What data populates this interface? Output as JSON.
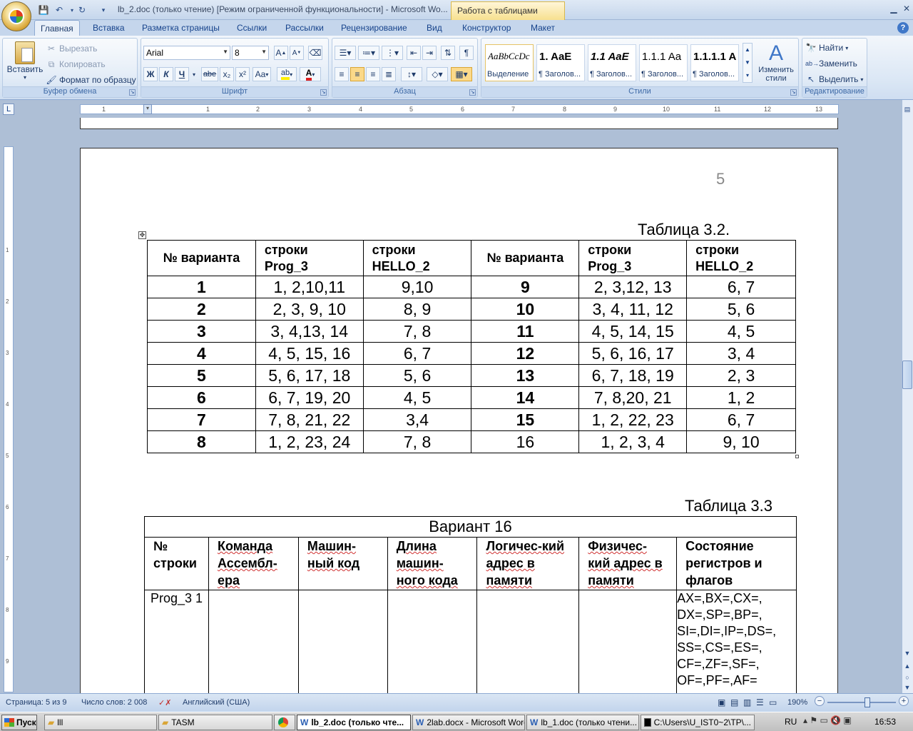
{
  "title_bar": {
    "document_title": "lb_2.doc (только чтение) [Режим ограниченной функциональности] - Microsoft Wo...",
    "context_tab": "Работа с таблицами"
  },
  "tabs": [
    "Главная",
    "Вставка",
    "Разметка страницы",
    "Ссылки",
    "Рассылки",
    "Рецензирование",
    "Вид",
    "Конструктор",
    "Макет"
  ],
  "ribbon": {
    "clipboard": {
      "paste": "Вставить",
      "cut": "Вырезать",
      "copy": "Копировать",
      "format_painter": "Формат по образцу",
      "label": "Буфер обмена"
    },
    "font": {
      "font_name": "Arial",
      "font_size": "8",
      "label": "Шрифт",
      "bold": "Ж",
      "italic": "К",
      "underline": "Ч",
      "strike": "abe",
      "sub": "x₂",
      "sup": "x²",
      "case": "Aa",
      "color": "A"
    },
    "paragraph": {
      "label": "Абзац"
    },
    "styles": {
      "label": "Стили",
      "items": [
        {
          "preview": "AaBbCcDc",
          "name": "Выделение"
        },
        {
          "preview": "1.  AaE",
          "name": "¶ Заголов..."
        },
        {
          "preview": "1.1  AaE",
          "name": "¶ Заголов..."
        },
        {
          "preview": "1.1.1  Aa",
          "name": "¶ Заголов..."
        },
        {
          "preview": "1.1.1.1  A",
          "name": "¶ Заголов..."
        }
      ],
      "change_styles": "Изменить стили"
    },
    "editing": {
      "find": "Найти",
      "replace": "Заменить",
      "select": "Выделить",
      "label": "Редактирование"
    }
  },
  "ruler_numbers": [
    "1",
    "1",
    "2",
    "3",
    "4",
    "5",
    "6",
    "7",
    "8",
    "9",
    "10",
    "11",
    "12",
    "13"
  ],
  "vruler_numbers": [
    "1",
    "2",
    "3",
    "4",
    "5",
    "6",
    "7",
    "8",
    "9"
  ],
  "document": {
    "page_number": "5",
    "table32": {
      "caption": "Таблица 3.2.",
      "headers": [
        "№ варианта",
        "строки Prog_3",
        "строки HELLO_2",
        "№ варианта",
        "строки Prog_3",
        "строки HELLO_2"
      ],
      "rows": [
        [
          "1",
          "1, 2,10,11",
          "9,10",
          "9",
          "2, 3,12, 13",
          "6, 7"
        ],
        [
          "2",
          "2, 3, 9, 10",
          "8, 9",
          "10",
          "3, 4, 11, 12",
          "5, 6"
        ],
        [
          "3",
          "3, 4,13, 14",
          "7, 8",
          "11",
          "4, 5, 14, 15",
          "4, 5"
        ],
        [
          "4",
          "4, 5, 15, 16",
          "6, 7",
          "12",
          "5, 6, 16, 17",
          "3, 4"
        ],
        [
          "5",
          "5, 6, 17, 18",
          "5, 6",
          "13",
          "6, 7, 18, 19",
          "2, 3"
        ],
        [
          "6",
          "6, 7, 19, 20",
          "4, 5",
          "14",
          "7, 8,20, 21",
          "1, 2"
        ],
        [
          "7",
          "7, 8, 21, 22",
          "3,4",
          "15",
          "1, 2, 22, 23",
          "6, 7"
        ],
        [
          "8",
          "1, 2, 23, 24",
          "7, 8",
          "16",
          "1, 2, 3, 4",
          "9, 10"
        ]
      ]
    },
    "table33": {
      "caption": "Таблица 3.3",
      "title": "Вариант 16",
      "headers": [
        "№ строки",
        "Команда Ассембл-ера",
        "Машин-ный код",
        "Длина машин-ного кода",
        "Логичес-кий адрес в памяти",
        "Физичес-кий адрес в памяти",
        "Состояние регистров и флагов"
      ],
      "row1": {
        "line": "Prog_3 1",
        "registers": "AX=,BX=,CX=, DX=,SP=,BP=, SI=,DI=,IP=,DS=, SS=,CS=,ES=, CF=,ZF=,SF=, OF=,PF=,AF="
      }
    }
  },
  "status_bar": {
    "page": "Страница: 5 из 9",
    "words": "Число слов: 2 008",
    "language": "Английский (США)",
    "zoom": "190%"
  },
  "taskbar": {
    "start": "Пуск",
    "items": [
      "lll",
      "TASM",
      "",
      "lb_2.doc (только чте...",
      "2lab.docx - Microsoft Word",
      "lb_1.doc (только чтени...",
      "C:\\Users\\U_IST0~2\\TP\\..."
    ],
    "lang": "RU",
    "clock": "16:53"
  }
}
